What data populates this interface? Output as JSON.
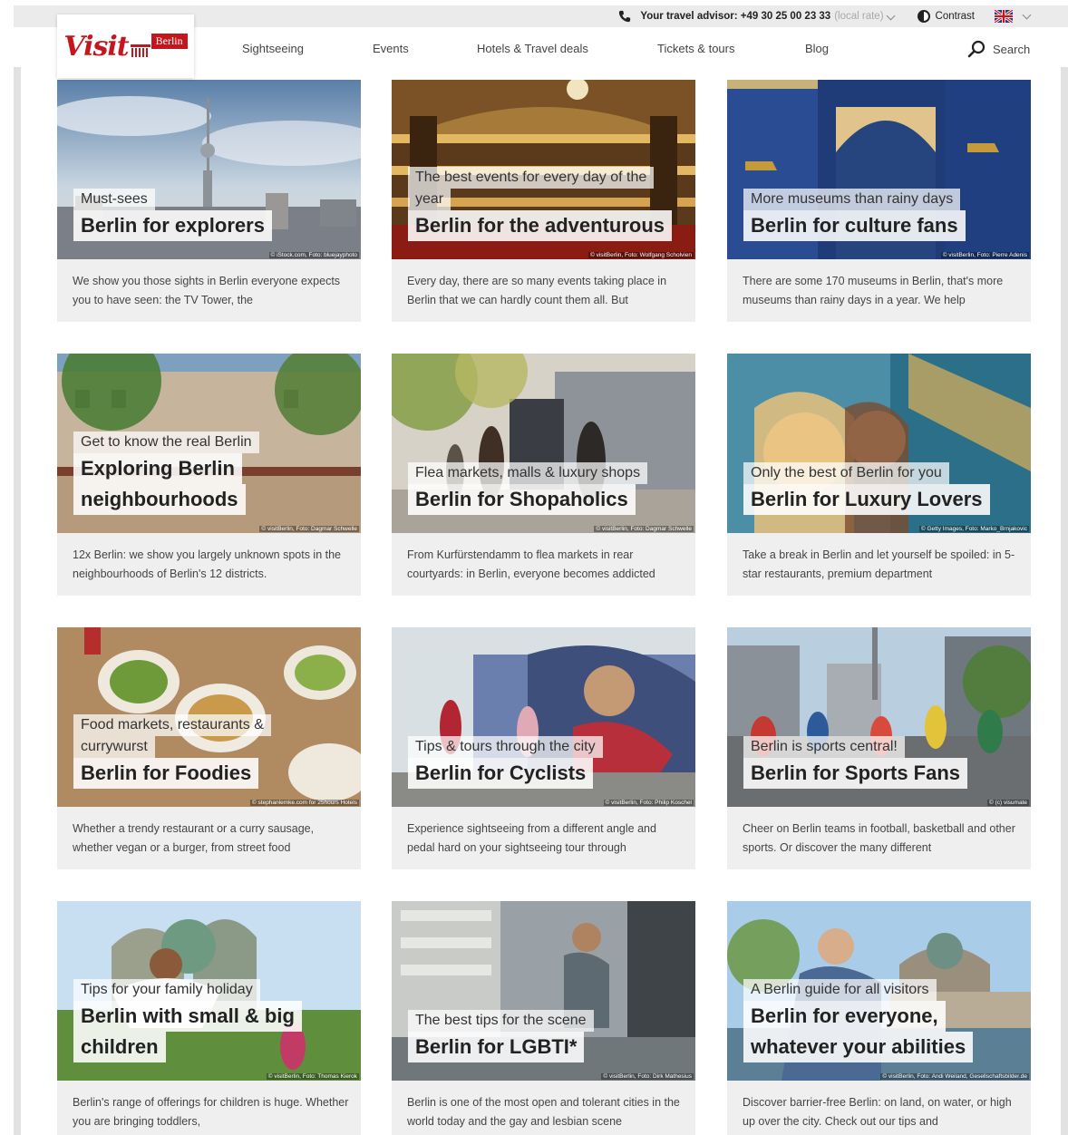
{
  "utility_bar": {
    "advisor_label": "Your travel advisor: +49 30 25 00 23 33",
    "advisor_note": "(local rate)",
    "contrast_label": "Contrast"
  },
  "logo": {
    "visit": "Visit",
    "berlin": "Berlin"
  },
  "nav": {
    "items": [
      "Sightseeing",
      "Events",
      "Hotels & Travel deals",
      "Tickets & tours",
      "Blog"
    ],
    "search_label": "Search"
  },
  "cards": [
    {
      "tag": [
        "Must-sees"
      ],
      "title": [
        "Berlin for explorers"
      ],
      "credit": "© iStock.com, Foto: bluejayphoto",
      "desc": "We show you those sights in Berlin everyone expects you to have seen: the TV Tower, the",
      "scene": "tower"
    },
    {
      "tag": [
        "The best events for every day of the",
        "year"
      ],
      "title": [
        "Berlin for the adventurous"
      ],
      "credit": "© visitBerlin, Foto: Wolfgang Scholvien",
      "desc": "Every day, there are so many events taking place in Berlin that we can hardly count them all. But",
      "scene": "opera"
    },
    {
      "tag": [
        "More museums than rainy days"
      ],
      "title": [
        "Berlin for culture fans"
      ],
      "credit": "© visitBerlin, Foto: Pierre Adenis",
      "desc": "There are some 170 museums in Berlin, that's more museums than rainy days in a year. We help",
      "scene": "museum"
    },
    {
      "tag": [
        "Get to know the real Berlin"
      ],
      "title": [
        "Exploring Berlin",
        "neighbourhoods"
      ],
      "credit": "© visitBerlin, Foto: Dagmar Schwelle",
      "desc": "12x Berlin: we show you largely unknown spots in the neighbourhoods of Berlin's 12 districts.",
      "scene": "square"
    },
    {
      "tag": [
        "Flea markets, malls & luxury shops"
      ],
      "title": [
        "Berlin for Shopaholics"
      ],
      "credit": "© visitBerlin, Foto: Dagmar Schwelle",
      "desc": "From Kurfürstendamm to flea markets in rear courtyards: in Berlin, everyone becomes addicted",
      "scene": "shopping"
    },
    {
      "tag": [
        "Only the best of Berlin for you"
      ],
      "title": [
        "Berlin for Luxury Lovers"
      ],
      "credit": "© Getty Images, Foto: Marko_Brnjakovic",
      "desc": "Take a break in Berlin and let yourself be spoiled: in 5-star restaurants, premium department",
      "scene": "luxury"
    },
    {
      "tag": [
        "Food markets, restaurants &",
        "currywurst"
      ],
      "title": [
        "Berlin for Foodies"
      ],
      "credit": "© stephanlemke.com for 25hours Hotels",
      "desc": "Whether a trendy restaurant or a curry sausage, whether vegan or a burger, from street food",
      "scene": "food"
    },
    {
      "tag": [
        "Tips & tours through the city"
      ],
      "title": [
        "Berlin for Cyclists"
      ],
      "credit": "© visitBerlin, Foto: Philip Koschel",
      "desc": "Experience sightseeing from a different angle and pedal hard on your sightseeing tour through",
      "scene": "cyclists"
    },
    {
      "tag": [
        "Berlin is sports central!"
      ],
      "title": [
        "Berlin for Sports Fans"
      ],
      "credit": "© (c) visumate",
      "desc": "Cheer on Berlin teams in football, basketball and other sports. Or discover the many different",
      "scene": "marathon"
    },
    {
      "tag": [
        "Tips for your family holiday"
      ],
      "title": [
        "Berlin with small & big",
        "children"
      ],
      "credit": "© visitBerlin, Foto: Thomas Kierok",
      "desc": "Berlin's range of offerings for children is huge. Whether you are bringing toddlers,",
      "scene": "family"
    },
    {
      "tag": [
        "The best tips for the scene"
      ],
      "title": [
        "Berlin for LGBTI*"
      ],
      "credit": "© visitBerlin, Foto: Dirk Mathesius",
      "desc": "Berlin is one of the most open and tolerant cities in the world today and the gay and lesbian scene",
      "scene": "lgbti"
    },
    {
      "tag": [
        "A Berlin guide for all visitors"
      ],
      "title": [
        "Berlin for everyone,",
        "whatever your abilities"
      ],
      "credit": "© visitBerlin, Foto: Andi Weiland, Gesellschaftsbilder.de",
      "desc": "Discover barrier-free Berlin: on land, on water, or high up over the city. Check out our tips and",
      "scene": "accessible"
    }
  ]
}
